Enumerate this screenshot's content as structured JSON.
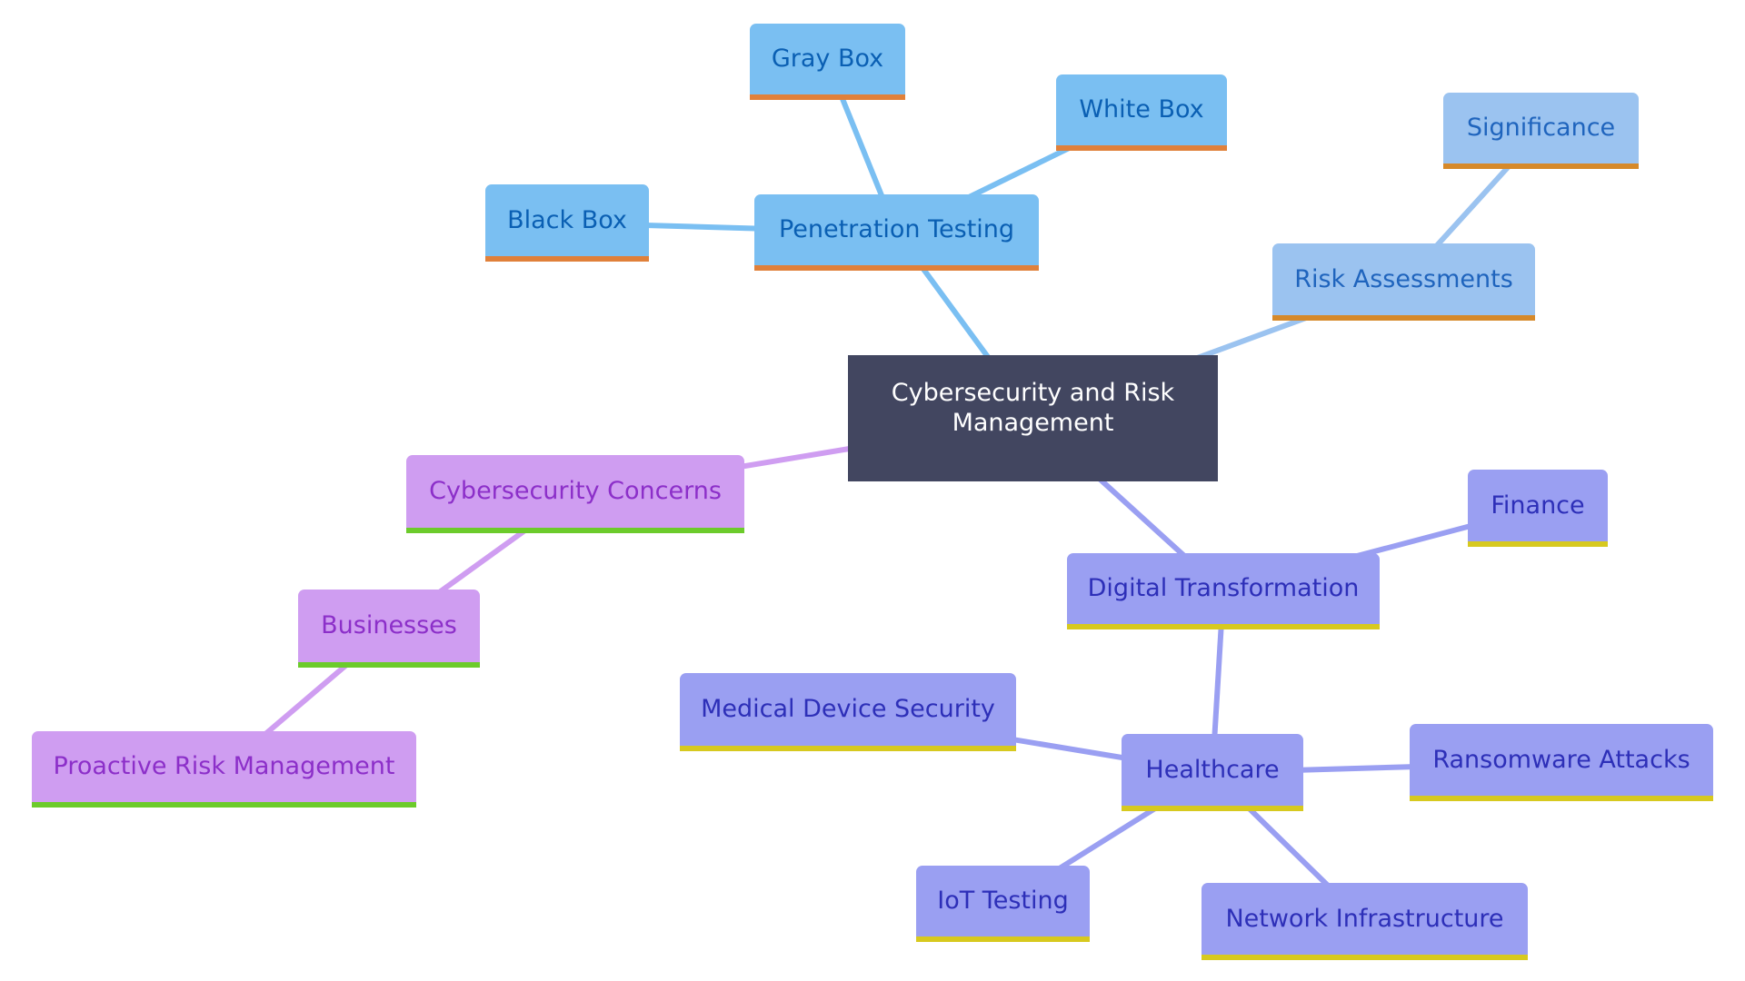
{
  "diagram": {
    "type": "mindmap",
    "root": {
      "id": "root",
      "label": "Cybersecurity and Risk Management"
    },
    "nodes": [
      {
        "id": "pen",
        "label": "Penetration Testing",
        "parent": "root",
        "branch": "pen"
      },
      {
        "id": "gray",
        "label": "Gray Box",
        "parent": "pen",
        "branch": "pen"
      },
      {
        "id": "white",
        "label": "White Box",
        "parent": "pen",
        "branch": "pen"
      },
      {
        "id": "black",
        "label": "Black Box",
        "parent": "pen",
        "branch": "pen"
      },
      {
        "id": "risk",
        "label": "Risk Assessments",
        "parent": "root",
        "branch": "risk"
      },
      {
        "id": "sig",
        "label": "Significance",
        "parent": "risk",
        "branch": "risk"
      },
      {
        "id": "concerns",
        "label": "Cybersecurity Concerns",
        "parent": "root",
        "branch": "cyber"
      },
      {
        "id": "biz",
        "label": "Businesses",
        "parent": "concerns",
        "branch": "cyber"
      },
      {
        "id": "proactive",
        "label": "Proactive Risk Management",
        "parent": "biz",
        "branch": "cyber"
      },
      {
        "id": "digital",
        "label": "Digital Transformation",
        "parent": "root",
        "branch": "digital"
      },
      {
        "id": "finance",
        "label": "Finance",
        "parent": "digital",
        "branch": "digital"
      },
      {
        "id": "health",
        "label": "Healthcare",
        "parent": "digital",
        "branch": "digital"
      },
      {
        "id": "medical",
        "label": "Medical Device Security",
        "parent": "health",
        "branch": "digital"
      },
      {
        "id": "ransom",
        "label": "Ransomware Attacks",
        "parent": "health",
        "branch": "digital"
      },
      {
        "id": "iot",
        "label": "IoT Testing",
        "parent": "health",
        "branch": "digital"
      },
      {
        "id": "network",
        "label": "Network Infrastructure",
        "parent": "health",
        "branch": "digital"
      }
    ],
    "branch_colors": {
      "root": {
        "fill": "#424660",
        "text": "#ffffff"
      },
      "pen": {
        "fill": "#7abff2",
        "text": "#0a5fb3",
        "accent": "#e0803a",
        "edge": "#7abff2"
      },
      "risk": {
        "fill": "#9bc3f0",
        "text": "#1f64bd",
        "accent": "#d6892a",
        "edge": "#9bc3f0"
      },
      "cyber": {
        "fill": "#cf9df1",
        "text": "#8c2fc9",
        "accent": "#6ccb2b",
        "edge": "#cf9df1"
      },
      "digital": {
        "fill": "#9a9ff2",
        "text": "#2d2fb8",
        "accent": "#d7c91f",
        "edge": "#9a9ff2"
      }
    }
  }
}
